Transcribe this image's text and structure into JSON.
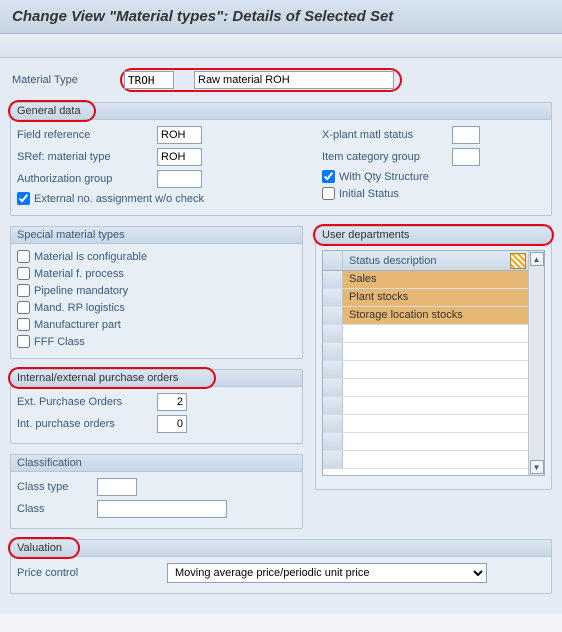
{
  "title": "Change View \"Material types\": Details of Selected Set",
  "material_type": {
    "label": "Material Type",
    "code": "TROH",
    "description": "Raw material ROH"
  },
  "general_data": {
    "title": "General data",
    "field_reference_label": "Field reference",
    "field_reference_value": "ROH",
    "sref_label": "SRef: material type",
    "sref_value": "ROH",
    "auth_group_label": "Authorization group",
    "auth_group_value": "",
    "ext_no_label": "External no. assignment w/o check",
    "ext_no_checked": true,
    "xplant_label": "X-plant matl status",
    "xplant_value": "",
    "item_cat_label": "Item category group",
    "item_cat_value": "",
    "with_qty_label": "With Qty Structure",
    "with_qty_checked": true,
    "initial_status_label": "Initial Status",
    "initial_status_checked": false
  },
  "special_material_types": {
    "title": "Special material types",
    "items": [
      {
        "label": "Material is configurable",
        "checked": false
      },
      {
        "label": "Material f. process",
        "checked": false
      },
      {
        "label": "Pipeline mandatory",
        "checked": false
      },
      {
        "label": "Mand. RP logistics",
        "checked": false
      },
      {
        "label": "Manufacturer part",
        "checked": false
      },
      {
        "label": "FFF Class",
        "checked": false
      }
    ]
  },
  "purchase_orders": {
    "title": "Internal/external purchase orders",
    "ext_label": "Ext. Purchase Orders",
    "ext_value": "2",
    "int_label": "Int. purchase orders",
    "int_value": "0"
  },
  "user_departments": {
    "title": "User departments",
    "header": "Status description",
    "rows": [
      "Sales",
      "Plant stocks",
      "Storage location stocks"
    ]
  },
  "classification": {
    "title": "Classification",
    "class_type_label": "Class type",
    "class_type_value": "",
    "class_label": "Class",
    "class_value": ""
  },
  "valuation": {
    "title": "Valuation",
    "price_control_label": "Price control",
    "price_control_value": "Moving average price/periodic unit price"
  }
}
